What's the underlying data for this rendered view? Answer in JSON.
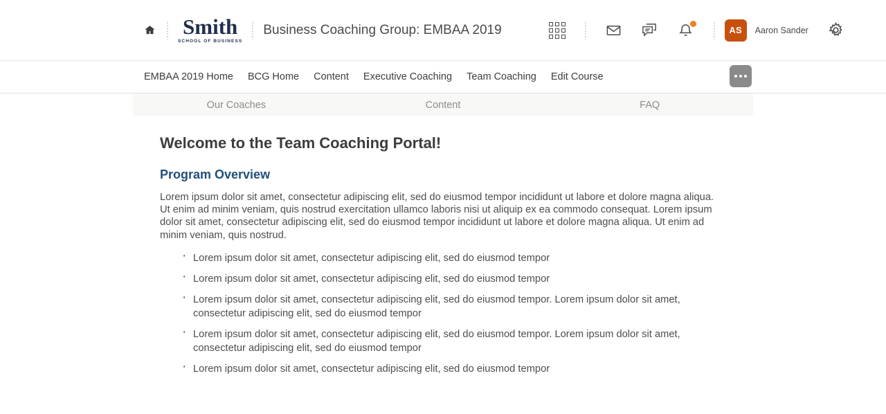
{
  "header": {
    "home_icon": "home-icon",
    "brand": {
      "name": "Smith",
      "subtitle": "SCHOOL OF BUSINESS"
    },
    "course_title": "Business Coaching Group: EMBAA 2019",
    "icons": {
      "apps": "apps-grid-icon",
      "mail": "envelope-icon",
      "chat": "chat-bubble-icon",
      "notifications": "bell-icon"
    },
    "user": {
      "initials": "AS",
      "name": "Aaron Sander",
      "avatar_color": "#c8500f"
    },
    "settings_icon": "gear-icon",
    "notification_badge_color": "#f08020"
  },
  "nav": {
    "items": [
      {
        "label": "EMBAA 2019 Home"
      },
      {
        "label": "BCG Home"
      },
      {
        "label": "Content"
      },
      {
        "label": "Executive Coaching"
      },
      {
        "label": "Team Coaching"
      },
      {
        "label": "Edit Course"
      }
    ],
    "more_button": "more-options-button"
  },
  "subtabs": [
    {
      "label": "Our Coaches"
    },
    {
      "label": "Content"
    },
    {
      "label": "FAQ"
    }
  ],
  "main": {
    "page_title": "Welcome to the Team Coaching Portal!",
    "section_title": "Program Overview",
    "paragraph": "Lorem ipsum dolor sit amet, consectetur adipiscing elit, sed do eiusmod tempor incididunt ut labore et dolore magna aliqua. Ut enim ad minim veniam, quis nostrud exercitation ullamco laboris nisi ut aliquip ex ea commodo consequat. Lorem ipsum dolor sit amet, consectetur adipiscing elit, sed do eiusmod tempor incididunt ut labore et dolore magna aliqua. Ut enim ad minim veniam, quis nostrud.",
    "bullets": [
      "Lorem ipsum dolor sit amet, consectetur adipiscing elit, sed do eiusmod tempor",
      "Lorem ipsum dolor sit amet, consectetur adipiscing elit, sed do eiusmod tempor",
      "Lorem ipsum dolor sit amet, consectetur adipiscing elit, sed do eiusmod tempor. Lorem ipsum dolor sit amet, consectetur adipiscing elit, sed do eiusmod tempor",
      "Lorem ipsum dolor sit amet, consectetur adipiscing elit, sed do eiusmod tempor. Lorem ipsum dolor sit amet, consectetur adipiscing elit, sed do eiusmod tempor",
      "Lorem ipsum dolor sit amet, consectetur adipiscing elit, sed do eiusmod tempor"
    ]
  }
}
